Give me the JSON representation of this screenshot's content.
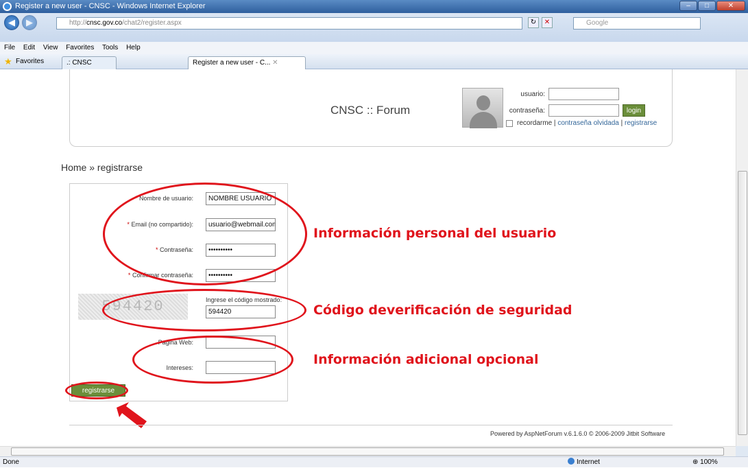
{
  "window": {
    "title": "Register a new user - CNSC - Windows Internet Explorer"
  },
  "address": {
    "url_prefix": "http://",
    "url_host": "cnsc.gov.co",
    "url_path": "/chat2/register.aspx",
    "search_placeholder": "Google"
  },
  "menu": [
    "File",
    "Edit",
    "View",
    "Favorites",
    "Tools",
    "Help"
  ],
  "favorites": {
    "label": "Favorites",
    "tabs": [
      ".: CNSC Comision Nacion...",
      "Register a new user - C..."
    ]
  },
  "header": {
    "site_title": "CNSC :: Forum",
    "usuario_label": "usuario:",
    "contrasena_label": "contraseña:",
    "login_button": "login",
    "remember": "recordarme",
    "forgot": "contraseña olvidada",
    "register": "registrarse",
    "sep": "|"
  },
  "breadcrumb": "Home » registrarse",
  "form": {
    "username_label": "Nombre de usuario:",
    "username_value": "NOMBRE USUARIO",
    "email_label": "Email (no compartido):",
    "email_value": "usuario@webmail.com",
    "password_label": "Contraseña:",
    "password_value": "••••••••••",
    "confirm_label": "Confirmar contraseña:",
    "confirm_value": "••••••••••",
    "captcha_image_text": "594420",
    "captcha_label": "Ingrese el código mostrado:",
    "captcha_value": "594420",
    "website_label": "Pagina Web:",
    "interests_label": "Intereses:",
    "submit": "registrarse",
    "required_mark": "*"
  },
  "annotations": {
    "personal": "Información personal del usuario",
    "security": "Código deverificación de seguridad",
    "optional": "Información adicional opcional"
  },
  "footer": "Powered by AspNetForum v.6.1.6.0 © 2006-2009 Jitbit Software",
  "status": {
    "left": "Done",
    "zone": "Internet",
    "zoom": "100%"
  },
  "colors": {
    "annotation": "#e0141c",
    "button": "#6b8e3a"
  }
}
